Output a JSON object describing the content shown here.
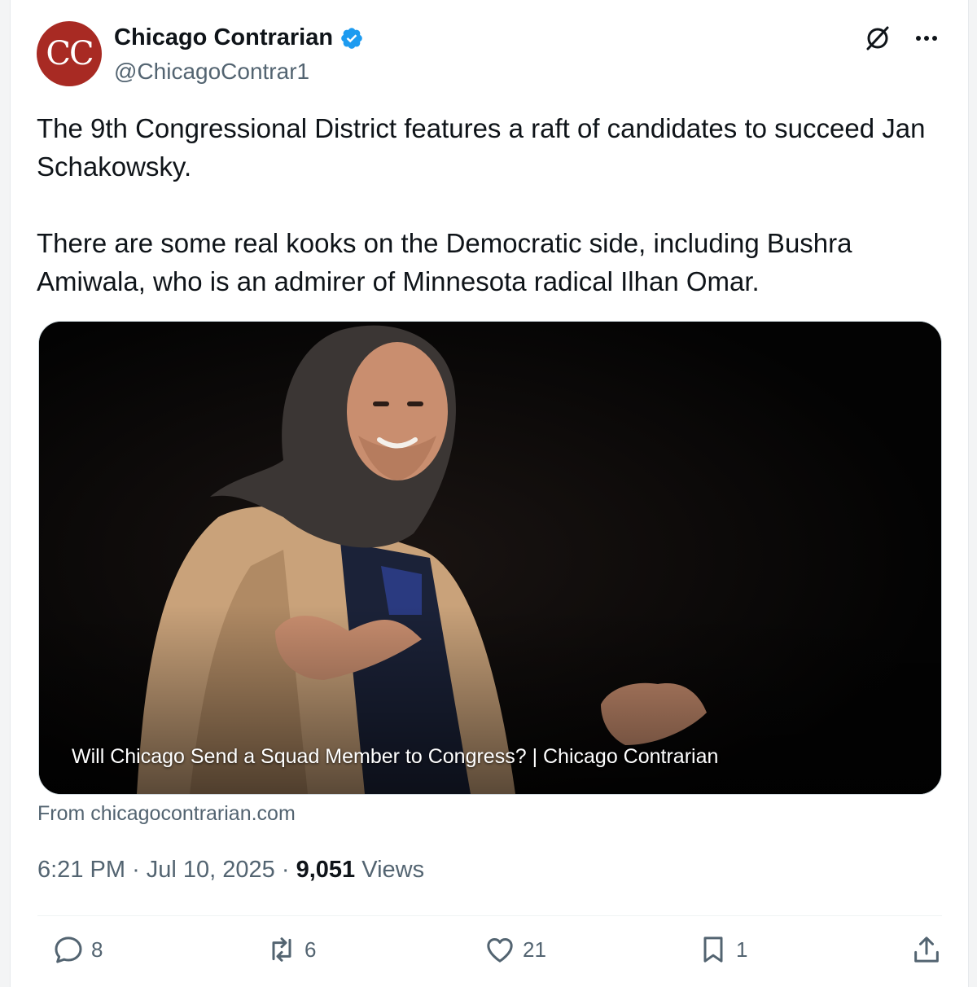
{
  "author": {
    "avatar_initials": "CC",
    "name": "Chicago Contrarian",
    "handle": "@ChicagoContrar1",
    "verified": true
  },
  "post": {
    "paragraph_1": "The 9th Congressional District features a raft of candidates to succeed Jan Schakowsky.",
    "paragraph_2": "There are some real kooks on the Democratic side, including Bushra Amiwala, who is an admirer of Minnesota radical Ilhan Omar."
  },
  "link_card": {
    "caption": "Will Chicago Send a Squad Member to Congress? | Chicago Contrarian",
    "source": "From chicagocontrarian.com"
  },
  "meta": {
    "time": "6:21 PM",
    "date": "Jul 10, 2025",
    "views_count": "9,051",
    "views_label": "Views",
    "separator": "·"
  },
  "actions": {
    "replies": "8",
    "reposts": "6",
    "likes": "21",
    "bookmarks": "1"
  },
  "colors": {
    "avatar_bg": "#a82a23",
    "verified": "#1d9bf0",
    "secondary_text": "#536471",
    "primary_text": "#0f1419"
  },
  "icons": [
    "verified-badge-icon",
    "grok-icon",
    "more-icon",
    "reply-icon",
    "repost-icon",
    "like-icon",
    "bookmark-icon",
    "share-icon"
  ]
}
